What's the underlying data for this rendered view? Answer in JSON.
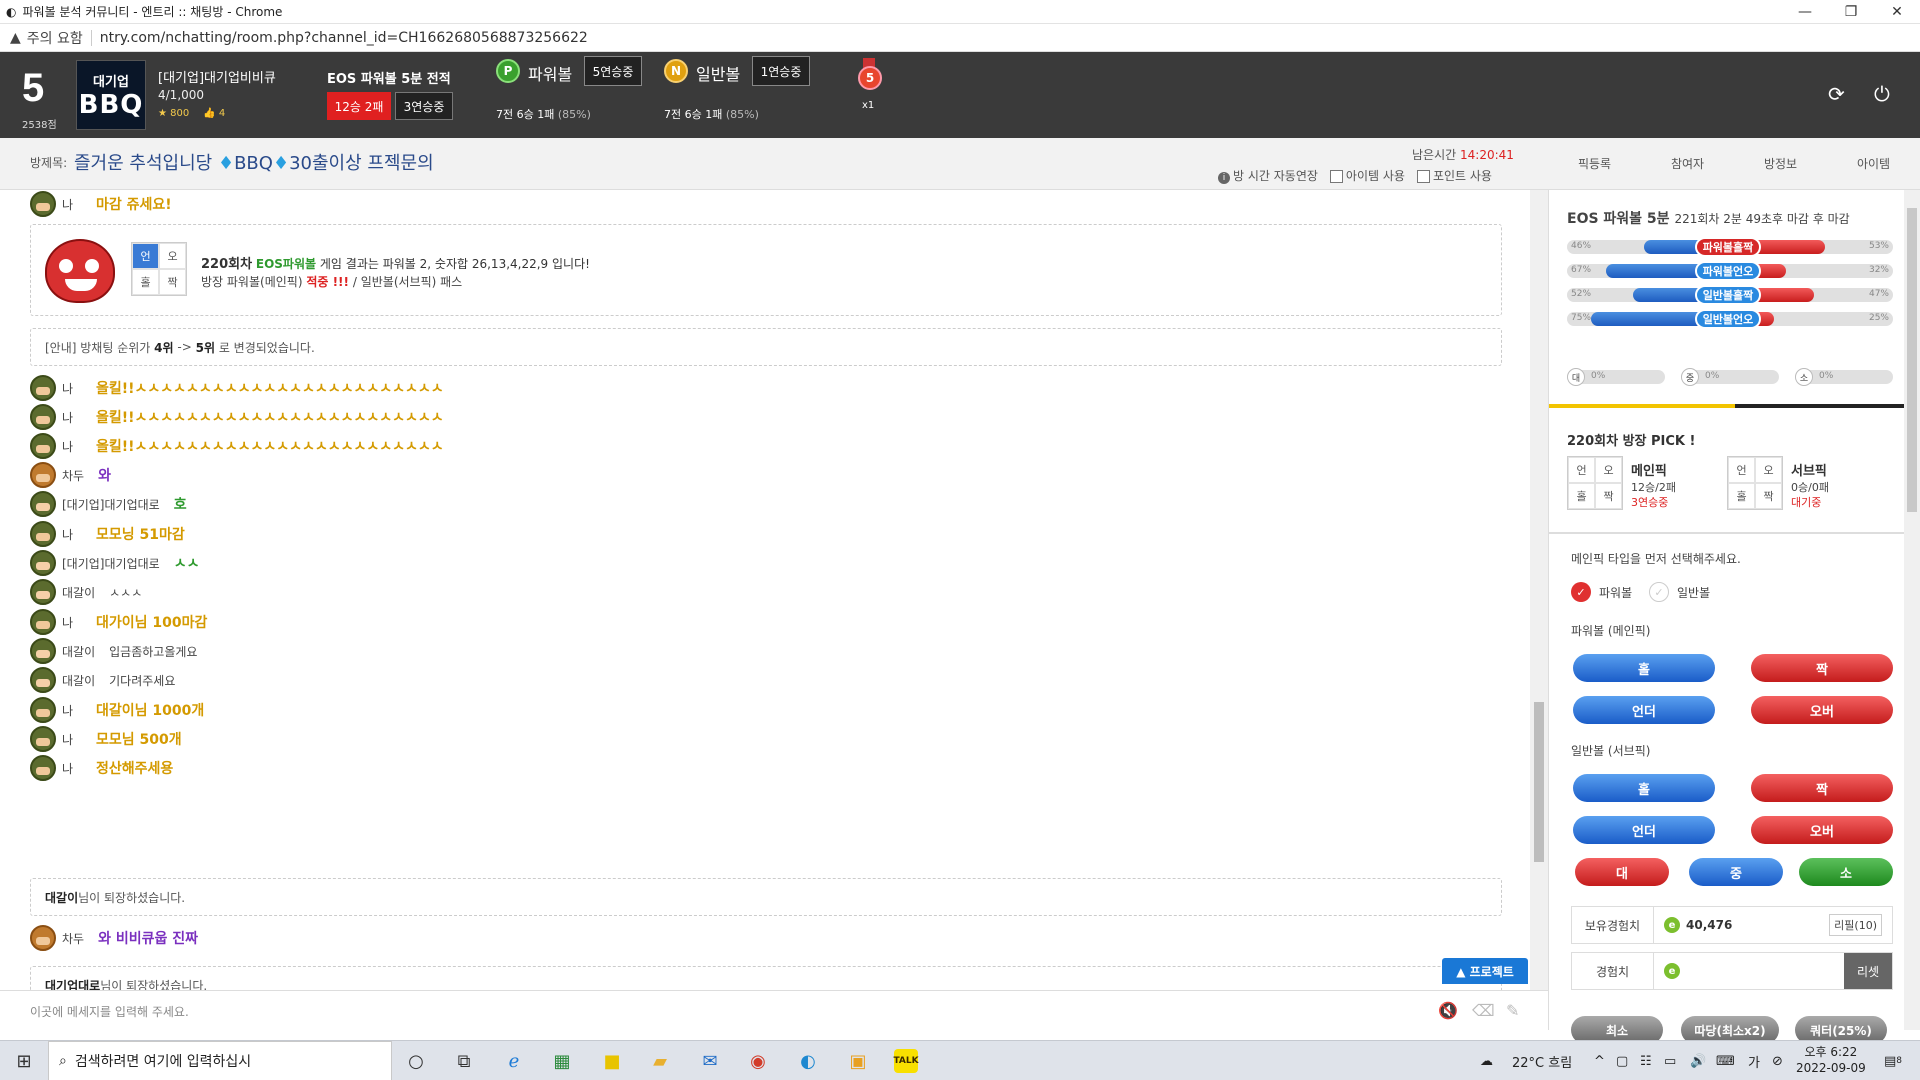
{
  "window": {
    "title": "파워볼 분석 커뮤니티 - 엔트리 :: 채팅방 - Chrome"
  },
  "address": {
    "warning": "주의 요함",
    "url": "ntry.com/nchatting/room.php?channel_id=CH1662680568873256622"
  },
  "header": {
    "level": "5",
    "score": "2538점",
    "logo_line1": "대기업",
    "logo_line2": "BBQ",
    "name": "[대기업]대기업비비큐",
    "count": "4/1,000",
    "stars": "800",
    "likes": "4",
    "eos_title": "EOS 파워볼 5분 전적",
    "record_badge": "12승 2패",
    "streak_badge": "3연승중",
    "powerball": {
      "icon": "P",
      "label": "파워볼",
      "badge": "5연승중",
      "record": "7전 6승 1패",
      "rate": "(85%)"
    },
    "normalball": {
      "icon": "N",
      "label": "일반볼",
      "badge": "1연승중",
      "record": "7전 6승 1패",
      "rate": "(85%)"
    },
    "medal_num": "5",
    "medal_mult": "x1"
  },
  "room": {
    "label": "방제목:",
    "title_a": "즐거운 추석입니당",
    "title_b": "BBQ",
    "title_c": "30출이상 프젝문의",
    "remain_label": "남은시간",
    "remain_time": "14:20:41",
    "opt_auto": "방 시간 자동연장",
    "opt_item": "아이템 사용",
    "opt_point": "포인트 사용"
  },
  "tabs": [
    "픽등록",
    "참여자",
    "방정보",
    "아이템"
  ],
  "chat": {
    "top_msg": {
      "nick": "나",
      "text": "마감 쥬세요!"
    },
    "result": {
      "grid": [
        "언",
        "오",
        "홀",
        "짝"
      ],
      "round": "220회차",
      "game": "EOS파워볼",
      "rest": "게임 결과는 파워볼 2, 숫자합 26,13,4,22,9 입니다!",
      "line2_a": "방장 파워볼(메인픽)",
      "line2_hit": "적중 !!!",
      "line2_b": "/ 일반볼(서브픽)",
      "line2_pass": "패스"
    },
    "notice1": {
      "prefix": "[안내] 방채팅 순위가",
      "from": "4위",
      "arrow": "->",
      "to": "5위",
      "suffix": "로 변경되었습니다."
    },
    "messages": [
      {
        "nick": "나",
        "text": "올킬!!ㅅㅅㅅㅅㅅㅅㅅㅅㅅㅅㅅㅅㅅㅅㅅㅅㅅㅅㅅㅅㅅㅅㅅㅅ",
        "color": "y"
      },
      {
        "nick": "나",
        "text": "올킬!!ㅅㅅㅅㅅㅅㅅㅅㅅㅅㅅㅅㅅㅅㅅㅅㅅㅅㅅㅅㅅㅅㅅㅅㅅ",
        "color": "y"
      },
      {
        "nick": "나",
        "text": "올킬!!ㅅㅅㅅㅅㅅㅅㅅㅅㅅㅅㅅㅅㅅㅅㅅㅅㅅㅅㅅㅅㅅㅅㅅㅅ",
        "color": "y"
      },
      {
        "nick": "차두",
        "text": "와",
        "color": "pu"
      },
      {
        "nick": "[대기업]대기업대로",
        "text": "호",
        "color": "gr"
      },
      {
        "nick": "나",
        "text": "모모닝 51마감",
        "color": "y"
      },
      {
        "nick": "[대기업]대기업대로",
        "text": "ㅅㅅ",
        "color": "gr"
      },
      {
        "nick": "대갈이",
        "text": "ㅅㅅㅅ",
        "color": "n"
      },
      {
        "nick": "나",
        "text": "대가이님 100마감",
        "color": "y"
      },
      {
        "nick": "대갈이",
        "text": "입금좀하고올게요",
        "color": "n"
      },
      {
        "nick": "대갈이",
        "text": "기다려주세요",
        "color": "n"
      },
      {
        "nick": "나",
        "text": "대갈이님 1000개",
        "color": "y"
      },
      {
        "nick": "나",
        "text": "모모님 500개",
        "color": "y"
      },
      {
        "nick": "나",
        "text": "정산해주세용",
        "color": "y"
      }
    ],
    "leave1": {
      "name": "대갈이",
      "text": "님이 퇴장하셨습니다."
    },
    "last_msg": {
      "nick": "차두",
      "text": "와 비비큐웁 진짜"
    },
    "leave2": {
      "name": "대기업대로",
      "text": "님이 퇴장하셨습니다."
    },
    "protect_btn": "▲ 프로젝트",
    "input_placeholder": "이곳에 메세지를 입력해 주세요."
  },
  "panel": {
    "head": "EOS 파워볼 5분",
    "head_sub": "221회차 2분 49초후 마감 후 마감",
    "bars": [
      {
        "left": "46%",
        "label": "파워볼홀짝",
        "right": "53%",
        "blue": 46,
        "red": 53,
        "pill": "r"
      },
      {
        "left": "67%",
        "label": "파워볼언오",
        "right": "32%",
        "blue": 67,
        "red": 32,
        "pill": "b"
      },
      {
        "left": "52%",
        "label": "일반볼홀짝",
        "right": "47%",
        "blue": 52,
        "red": 47,
        "pill": "b"
      },
      {
        "left": "75%",
        "label": "일반볼언오",
        "right": "25%",
        "blue": 75,
        "red": 25,
        "pill": "b"
      }
    ],
    "small_bars": [
      {
        "icon": "대",
        "pct": "0%"
      },
      {
        "icon": "중",
        "pct": "0%"
      },
      {
        "icon": "소",
        "pct": "0%"
      }
    ],
    "pick_title": "220회차 방장 PICK !",
    "main_pick": {
      "grid": [
        "언",
        "오",
        "홀",
        "짝"
      ],
      "name": "메인픽",
      "record": "12승/2패",
      "status": "3연승중"
    },
    "sub_pick": {
      "grid": [
        "언",
        "오",
        "홀",
        "짝"
      ],
      "name": "서브픽",
      "record": "0승/0패",
      "status": "대기중"
    },
    "hint": "메인픽 타입을 먼저 선택해주세요.",
    "radio_power": "파워볼",
    "radio_normal": "일반볼",
    "sect_main": "파워볼 (메인픽)",
    "sect_sub": "일반볼 (서브픽)",
    "btns": {
      "odd": "홀",
      "even": "짝",
      "under": "언더",
      "over": "오버",
      "big": "대",
      "mid": "중",
      "small": "소"
    },
    "exp_label": "보유경험치",
    "exp_value": "40,476",
    "refill": "리필(10)",
    "exp2_label": "경험치",
    "reset": "리셋",
    "bottom": [
      "최소",
      "따당(최소x2)",
      "쿼터(25%)"
    ]
  },
  "taskbar": {
    "search": "검색하려면 여기에 입력하십시",
    "weather": "22°C 흐림",
    "ampm_time": "오후 6:22",
    "date": "2022-09-09",
    "notif": "8"
  }
}
